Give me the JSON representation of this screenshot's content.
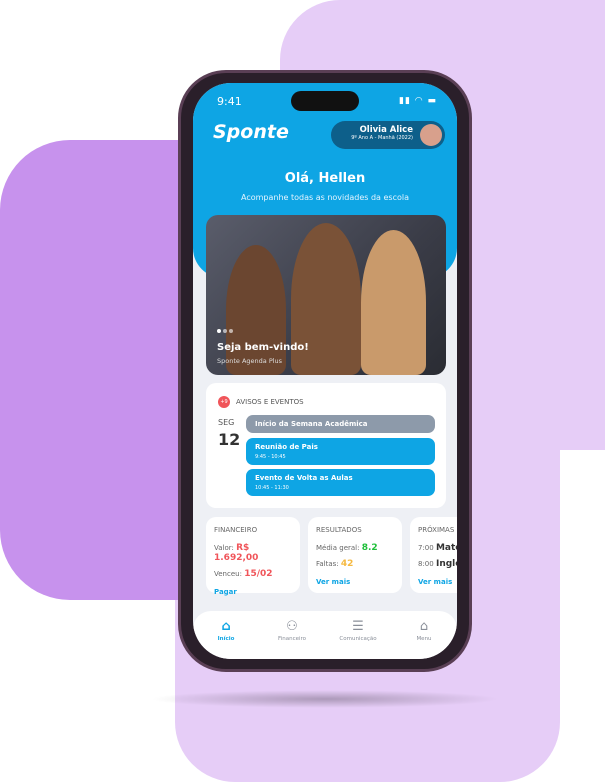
{
  "status": {
    "time": "9:41"
  },
  "header": {
    "logo": "Sponte",
    "user_name": "Olivia Alice",
    "user_class": "9º Ano A - Manhã (2022)",
    "greeting": "Olá, Hellen",
    "subtitle": "Acompanhe todas as novidades da escola"
  },
  "banner": {
    "title": "Seja bem-vindo!",
    "subtitle": "Sponte Agenda Plus"
  },
  "events": {
    "badge": "+9",
    "title": "AVISOS E EVENTOS",
    "weekday": "SEG",
    "day": "12",
    "items": [
      {
        "title": "Início da Semana Acadêmica",
        "time": ""
      },
      {
        "title": "Reunião de Pais",
        "time": "9:45 - 10:45"
      },
      {
        "title": "Evento de Volta as Aulas",
        "time": "10:45 - 11:30"
      }
    ]
  },
  "financeiro": {
    "title": "FINANCEIRO",
    "valor_label": "Valor:",
    "valor": "R$ 1.692,00",
    "venc_label": "Venceu:",
    "venc": "15/02",
    "link": "Pagar"
  },
  "resultados": {
    "title": "RESULTADOS",
    "media_label": "Média geral:",
    "media": "8.2",
    "faltas_label": "Faltas:",
    "faltas": "42",
    "link": "Ver mais"
  },
  "proximas": {
    "title": "PRÓXIMAS",
    "r1_time": "7:00",
    "r1": "Matemática",
    "r2_time": "8:00",
    "r2": "Inglês",
    "link": "Ver mais"
  },
  "nav": [
    {
      "label": "Início",
      "icon": "home"
    },
    {
      "label": "Financeiro",
      "icon": "money"
    },
    {
      "label": "Comunicação",
      "icon": "chat"
    },
    {
      "label": "Menu",
      "icon": "home"
    }
  ],
  "colors": {
    "primary": "#0ea5e4",
    "danger": "#f0555a",
    "success": "#1fbf3a",
    "warning": "#f5b941"
  }
}
